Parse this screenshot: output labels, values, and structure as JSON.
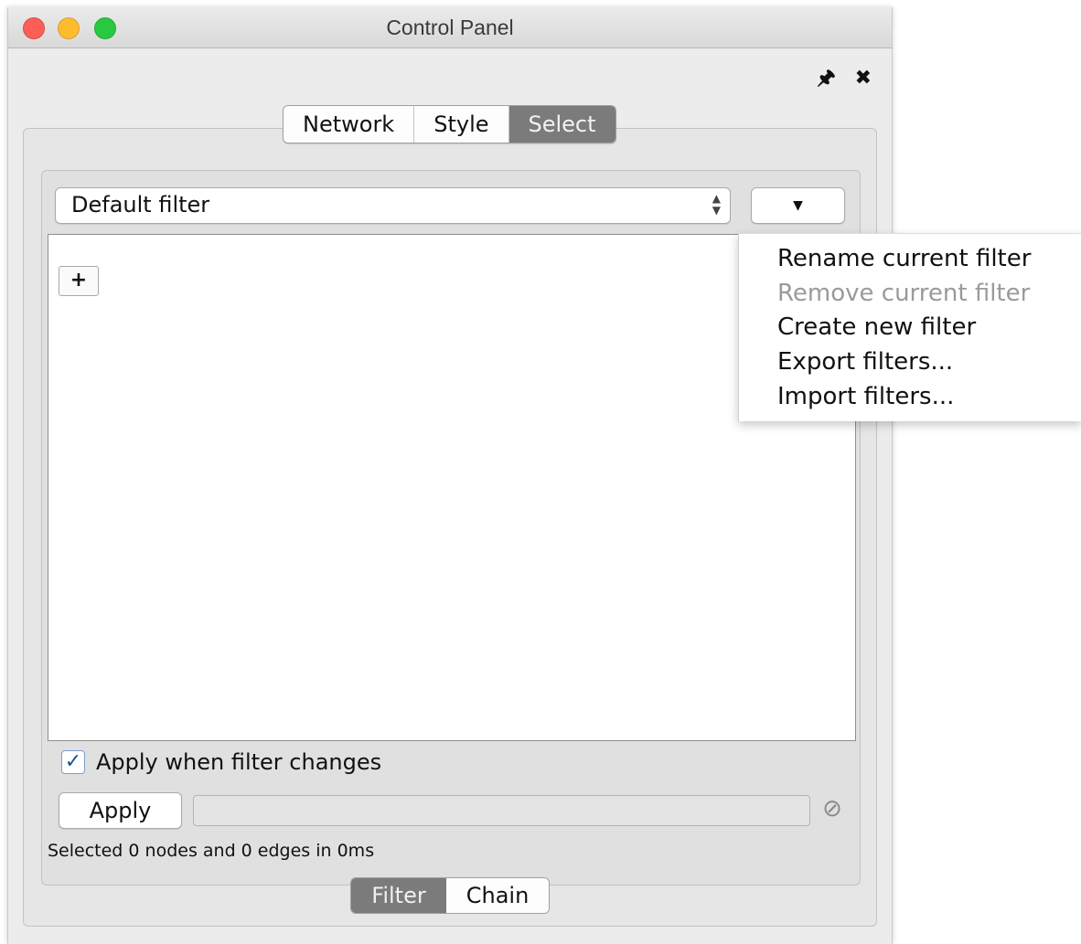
{
  "window": {
    "title": "Control Panel",
    "pin_icon": "pin-icon",
    "close_icon": "close-icon"
  },
  "tabs": [
    {
      "label": "Network",
      "active": false
    },
    {
      "label": "Style",
      "active": false
    },
    {
      "label": "Select",
      "active": true
    }
  ],
  "filter": {
    "selected": "Default filter",
    "menu_button_icon": "caret-down-icon",
    "add_button_label": "+"
  },
  "menu": {
    "items": [
      {
        "label": "Rename current filter",
        "enabled": true
      },
      {
        "label": "Remove current filter",
        "enabled": false
      },
      {
        "label": "Create new filter",
        "enabled": true
      },
      {
        "label": "Export filters...",
        "enabled": true
      },
      {
        "label": "Import filters...",
        "enabled": true
      }
    ]
  },
  "apply_section": {
    "checkbox_label": "Apply when filter changes",
    "checked": true,
    "apply_button": "Apply",
    "progress": 0,
    "cancel_icon": "cancel-icon",
    "status": "Selected 0 nodes and 0 edges in 0ms"
  },
  "bottom_tabs": [
    {
      "label": "Filter",
      "active": true
    },
    {
      "label": "Chain",
      "active": false
    }
  ],
  "colors": {
    "active_tab": "#7b7b7b",
    "checkbox_check": "#1d4f9c",
    "disabled_text": "#9a9a9a"
  }
}
